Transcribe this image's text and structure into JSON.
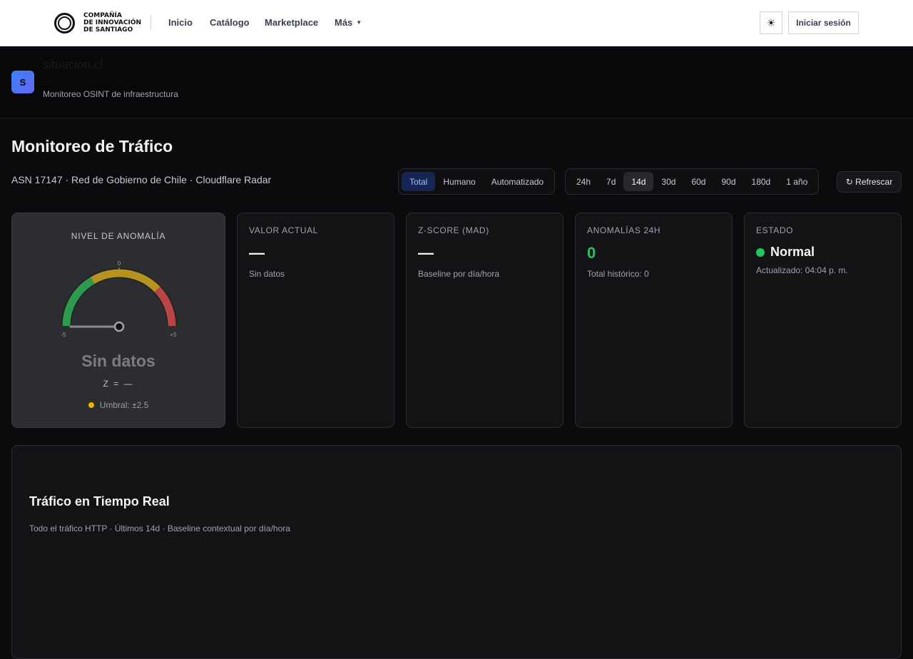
{
  "topnav": {
    "logo_lines": [
      "COMPAÑÍA",
      "DE INNOVACIÓN",
      "DE SANTIAGO"
    ],
    "links": [
      "Inicio",
      "Catálogo",
      "Marketplace",
      "Más"
    ],
    "theme_icon": "sun-icon",
    "login_label": "Iniciar sesión"
  },
  "site": {
    "badge": "S",
    "name": "situacion.cl",
    "tagline": "Monitoreo OSINT de infraestructura"
  },
  "page": {
    "title": "Monitoreo de Tráfico",
    "subtitle": "ASN 17147 · Red de Gobierno de Chile · Cloudflare Radar"
  },
  "filters": {
    "types": [
      "Total",
      "Humano",
      "Automatizado"
    ],
    "type_selected": "Total",
    "ranges": [
      "24h",
      "7d",
      "14d",
      "30d",
      "60d",
      "90d",
      "180d",
      "1 año"
    ],
    "range_selected": "14d",
    "refresh_label": "↻ Refrescar"
  },
  "gauge": {
    "title": "NIVEL DE ANOMALÍA",
    "min_label": "-5",
    "mid_label": "0",
    "max_label": "+5",
    "status": "Sin datos",
    "z_text": "Z = —",
    "threshold": "Umbral: ±2.5",
    "colors": {
      "good": "#22c55e",
      "warn": "#eab308",
      "bad": "#ef4444"
    }
  },
  "stats": {
    "valor": {
      "label": "VALOR ACTUAL",
      "value": "—",
      "sub": "Sin datos"
    },
    "zscore": {
      "label": "Z-SCORE (MAD)",
      "value": "—",
      "sub": "Baseline por día/hora"
    },
    "anomalias": {
      "label": "ANOMALÍAS 24H",
      "value": "0",
      "sub": "Total histórico: 0"
    },
    "estado": {
      "label": "ESTADO",
      "value": "Normal",
      "sub": "Actualizado: 04:04 p. m."
    }
  },
  "traffic": {
    "title": "Tráfico en Tiempo Real",
    "subtitle": "Todo el tráfico HTTP · Últimos 14d · Baseline contextual por día/hora"
  }
}
